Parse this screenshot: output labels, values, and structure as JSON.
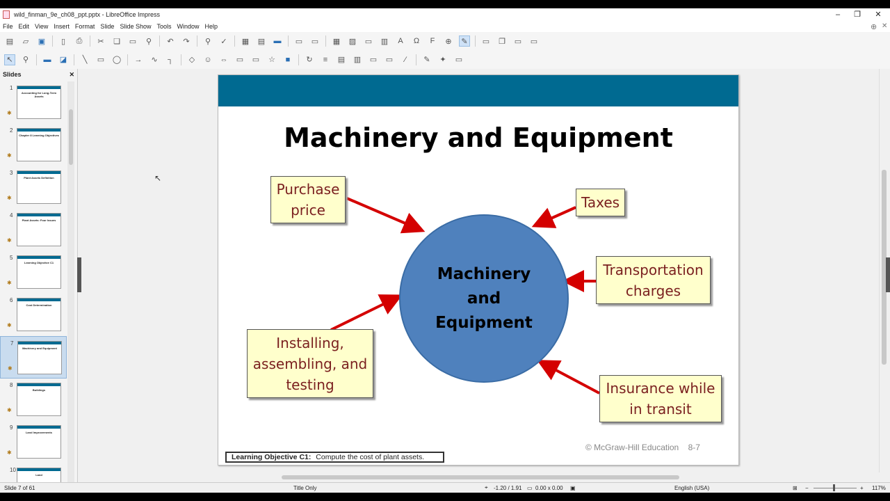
{
  "window": {
    "title": "wild_finman_9e_ch08_ppt.pptx - LibreOffice Impress"
  },
  "menu": [
    "File",
    "Edit",
    "View",
    "Insert",
    "Format",
    "Slide",
    "Slide Show",
    "Tools",
    "Window",
    "Help"
  ],
  "slides_panel": {
    "heading": "Slides",
    "thumbs": [
      {
        "num": "1",
        "title": "Accounting for Long-Term Assets"
      },
      {
        "num": "2",
        "title": "Chapter 8 Learning Objectives"
      },
      {
        "num": "3",
        "title": "Plant Assets Definition"
      },
      {
        "num": "4",
        "title": "Plant Assets: Four Issues"
      },
      {
        "num": "5",
        "title": "Learning Objective C1"
      },
      {
        "num": "6",
        "title": "Cost Determination"
      },
      {
        "num": "7",
        "title": "Machinery and Equipment"
      },
      {
        "num": "8",
        "title": "Buildings"
      },
      {
        "num": "9",
        "title": "Land Improvements"
      },
      {
        "num": "10",
        "title": "Land"
      }
    ]
  },
  "slide": {
    "title": "Machinery and Equipment",
    "center": [
      "Machinery",
      "and",
      "Equipment"
    ],
    "boxes": {
      "purchase": [
        "Purchase",
        "price"
      ],
      "taxes": [
        "Taxes"
      ],
      "transport": [
        "Transportation",
        "charges"
      ],
      "installing": [
        "Installing,",
        "assembling, and",
        "testing"
      ],
      "insurance": [
        "Insurance while",
        "in transit"
      ]
    },
    "copyright": "© McGraw-Hill Education",
    "page": "8-7",
    "learning_objective_label": "Learning Objective C1:",
    "learning_objective_text": "Compute the cost of plant assets."
  },
  "status": {
    "slide": "Slide 7 of 61",
    "layout": "Title Only",
    "position": "-1.20 / 1.91",
    "size": "0.00 x 0.00",
    "language": "English (USA)",
    "zoom": "117%"
  }
}
